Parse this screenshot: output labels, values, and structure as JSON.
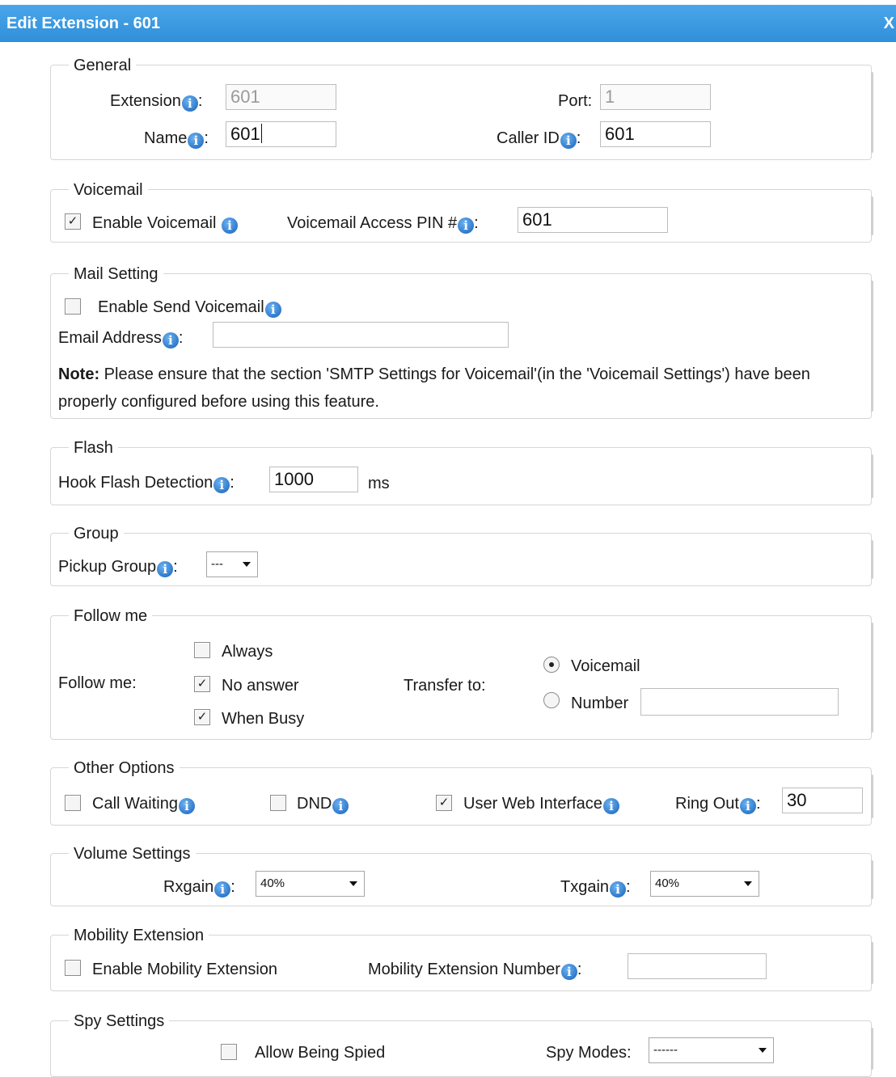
{
  "dialog": {
    "title": "Edit Extension - 601",
    "close": "X"
  },
  "general": {
    "legend": "General",
    "extension_label": "Extension",
    "extension_value": "601",
    "port_label": "Port:",
    "port_value": "1",
    "name_label": "Name",
    "name_value": "601",
    "callerid_label": "Caller ID",
    "callerid_value": "601"
  },
  "voicemail": {
    "legend": "Voicemail",
    "enable_label": "Enable Voicemail",
    "enable_checked": true,
    "pin_label": "Voicemail Access PIN #",
    "pin_value": "601"
  },
  "mail": {
    "legend": "Mail Setting",
    "enable_send_label": "Enable Send Voicemail",
    "enable_send_checked": false,
    "email_label": "Email Address",
    "email_value": "",
    "note_bold": "Note:",
    "note_text": " Please ensure that the section 'SMTP Settings for Voicemail'(in the 'Voicemail Settings') have been properly configured before using this feature."
  },
  "flash": {
    "legend": "Flash",
    "hook_label": "Hook Flash Detection",
    "hook_value": "1000",
    "unit": "ms"
  },
  "group": {
    "legend": "Group",
    "pickup_label": "Pickup Group",
    "pickup_value": "---"
  },
  "followme": {
    "legend": "Follow me",
    "label": "Follow me:",
    "always_label": "Always",
    "always_checked": false,
    "noanswer_label": "No answer",
    "noanswer_checked": true,
    "busy_label": "When Busy",
    "busy_checked": true,
    "transfer_label": "Transfer to:",
    "voicemail_label": "Voicemail",
    "voicemail_selected": true,
    "number_label": "Number",
    "number_value": ""
  },
  "other": {
    "legend": "Other Options",
    "callwaiting_label": "Call Waiting",
    "callwaiting_checked": false,
    "dnd_label": "DND",
    "dnd_checked": false,
    "webui_label": "User Web Interface",
    "webui_checked": true,
    "ringout_label": "Ring Out",
    "ringout_value": "30"
  },
  "volume": {
    "legend": "Volume Settings",
    "rx_label": "Rxgain",
    "rx_value": "40%",
    "tx_label": "Txgain",
    "tx_value": "40%"
  },
  "mobility": {
    "legend": "Mobility Extension",
    "enable_label": "Enable Mobility Extension",
    "enable_checked": false,
    "number_label": "Mobility Extension Number",
    "number_value": ""
  },
  "spy": {
    "legend": "Spy Settings",
    "allow_label": "Allow Being Spied",
    "allow_checked": false,
    "modes_label": "Spy Modes:",
    "modes_value": "------"
  },
  "icons": {
    "info": "info-icon",
    "check": "✓",
    "colon": ":"
  }
}
